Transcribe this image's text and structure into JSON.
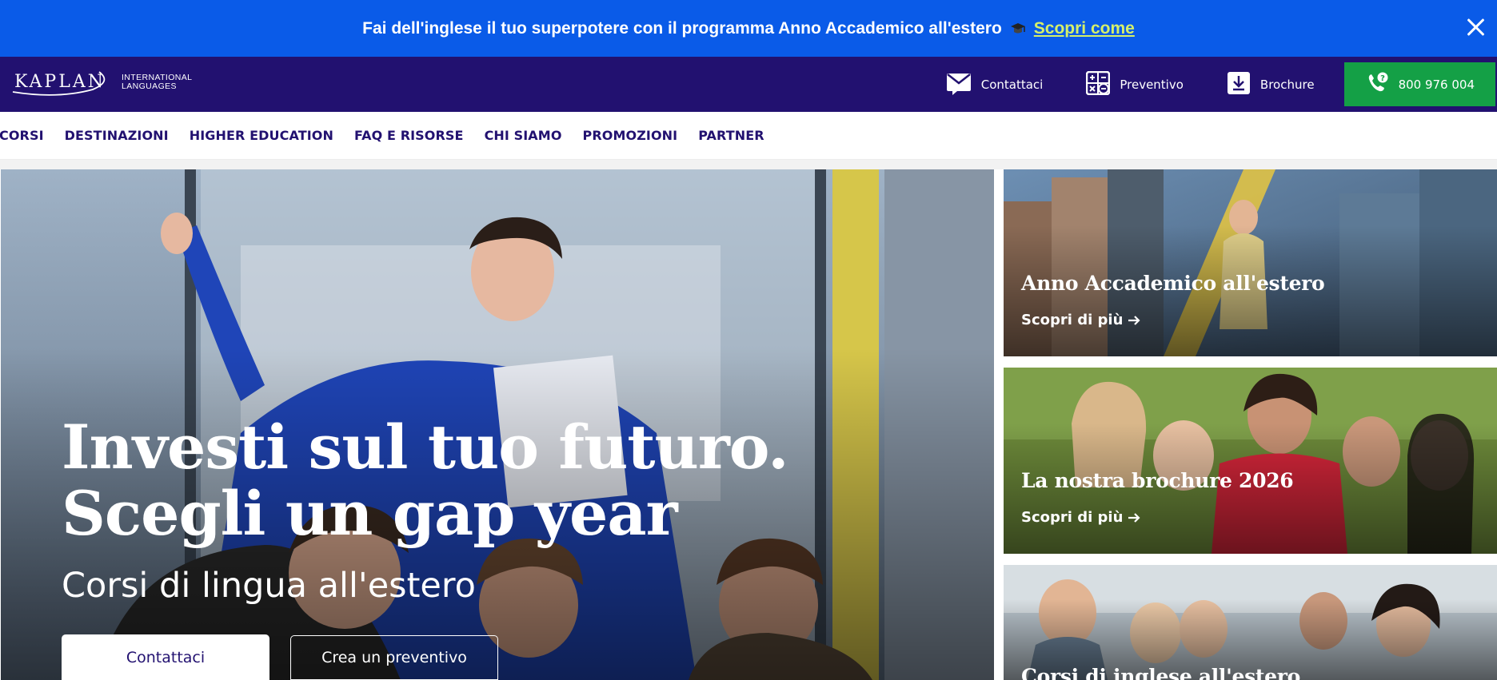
{
  "promo": {
    "text": "Fai dell'inglese il tuo superpotere con il programma Anno Accademico all'estero",
    "link": "Scopri come",
    "icons": {
      "cap": "graduation-cap-icon",
      "close": "close-icon"
    },
    "colors": {
      "background": "#0a5be8",
      "link": "#d5f06a"
    }
  },
  "header": {
    "logo_word": "KAPLAN",
    "logo_sub_1": "INTERNATIONAL",
    "logo_sub_2": "LANGUAGES",
    "contact_label": "Contattaci",
    "quote_label": "Preventivo",
    "brochure_label": "Brochure",
    "phone_label": "800 976 004",
    "icons": {
      "contact": "envelope-icon",
      "quote": "calculator-icon",
      "brochure": "download-icon",
      "phone": "phone-icon"
    },
    "colors": {
      "background": "#221170",
      "phone_button": "#14a046"
    }
  },
  "nav": {
    "items": [
      "CORSI",
      "DESTINAZIONI",
      "HIGHER EDUCATION",
      "FAQ E RISORSE",
      "CHI SIAMO",
      "PROMOZIONI",
      "PARTNER"
    ]
  },
  "hero": {
    "title": "Investi sul tuo futuro. Scegli un gap year",
    "subtitle": "Corsi di lingua all'estero",
    "primary_button": "Contattaci",
    "secondary_button": "Crea un preventivo"
  },
  "cards": [
    {
      "title": "Anno Accademico all'estero",
      "link": "Scopri di più"
    },
    {
      "title": "La nostra brochure 2026",
      "link": "Scopri di più"
    },
    {
      "title": "Corsi di inglese all'estero"
    }
  ]
}
